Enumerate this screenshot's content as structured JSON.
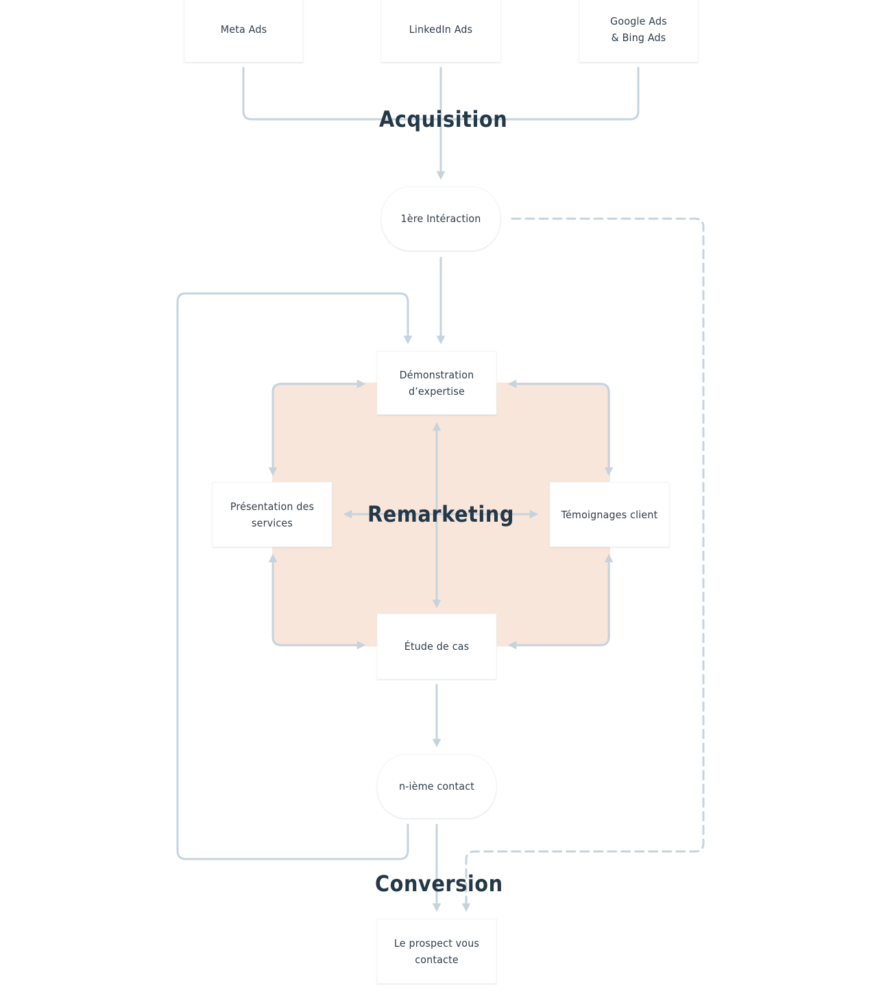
{
  "diagram": {
    "colors": {
      "connector": "#c6d3dd",
      "remarketing_fill": "#f9e6da",
      "text": "#2f3d4a",
      "stage_text": "#243847",
      "node_fill": "#ffffff"
    },
    "stages": {
      "acquisition": "Acquisition",
      "remarketing": "Remarketing",
      "conversion": "Conversion"
    },
    "sources": [
      {
        "label": "Meta Ads"
      },
      {
        "label": "LinkedIn Ads"
      },
      {
        "label": "Google Ads\n& Bing Ads"
      }
    ],
    "first_interaction": "1ère Intéraction",
    "remarketing_nodes": {
      "top": "Démonstration\nd’expertise",
      "left": "Présentation des\nservices",
      "right": "Témoignages client",
      "bottom": "Étude de cas"
    },
    "nth_contact": "n-ième contact",
    "outcome": "Le prospect vous\ncontacte",
    "edges": [
      {
        "from": "Meta Ads",
        "to": "1ère Intéraction",
        "style": "solid"
      },
      {
        "from": "LinkedIn Ads",
        "to": "1ère Intéraction",
        "style": "solid"
      },
      {
        "from": "Google Ads & Bing Ads",
        "to": "1ère Intéraction",
        "style": "solid"
      },
      {
        "from": "1ère Intéraction",
        "to": "Démonstration d’expertise",
        "style": "solid"
      },
      {
        "from": "1ère Intéraction",
        "to": "Le prospect vous contacte",
        "style": "dashed"
      },
      {
        "from": "Démonstration d’expertise",
        "to": "Présentation des services",
        "style": "solid"
      },
      {
        "from": "Présentation des services",
        "to": "Démonstration d’expertise",
        "style": "solid"
      },
      {
        "from": "Démonstration d’expertise",
        "to": "Témoignages client",
        "style": "solid"
      },
      {
        "from": "Témoignages client",
        "to": "Démonstration d’expertise",
        "style": "solid"
      },
      {
        "from": "Démonstration d’expertise",
        "to": "Étude de cas",
        "style": "solid",
        "bidirectional": true
      },
      {
        "from": "Présentation des services",
        "to": "Témoignages client",
        "style": "solid",
        "bidirectional": true
      },
      {
        "from": "Présentation des services",
        "to": "Étude de cas",
        "style": "solid"
      },
      {
        "from": "Étude de cas",
        "to": "Présentation des services",
        "style": "solid"
      },
      {
        "from": "Témoignages client",
        "to": "Étude de cas",
        "style": "solid"
      },
      {
        "from": "Étude de cas",
        "to": "Témoignages client",
        "style": "solid"
      },
      {
        "from": "Étude de cas",
        "to": "n-ième contact",
        "style": "solid"
      },
      {
        "from": "n-ième contact",
        "to": "Démonstration d’expertise",
        "style": "solid"
      },
      {
        "from": "n-ième contact",
        "to": "Le prospect vous contacte",
        "style": "solid"
      }
    ]
  }
}
